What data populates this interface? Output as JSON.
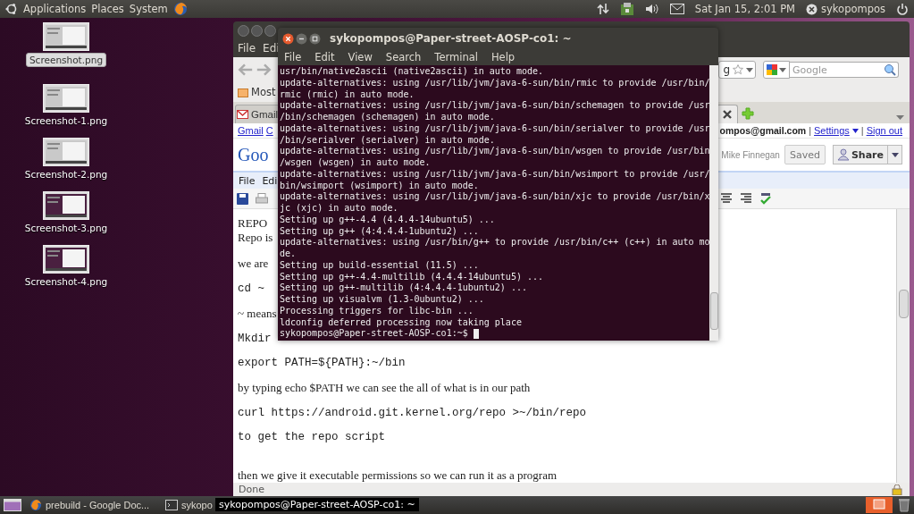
{
  "top_panel": {
    "menus": [
      "Applications",
      "Places",
      "System"
    ],
    "clock": "Sat Jan 15, 2:01 PM",
    "user": "sykopompos"
  },
  "desktop_icons": [
    {
      "label": "Screenshot.png",
      "selected": true
    },
    {
      "label": "Screenshot-1.png",
      "selected": false
    },
    {
      "label": "Screenshot-2.png",
      "selected": false
    },
    {
      "label": "Screenshot-3.png",
      "selected": false
    },
    {
      "label": "Screenshot-4.png",
      "selected": false
    }
  ],
  "firefox": {
    "menu": [
      "File",
      "Edi"
    ],
    "address_partial": "g",
    "search": {
      "placeholder": "Google"
    },
    "bookmarks": [
      "Most"
    ],
    "tabs": [
      {
        "label": "Gmail",
        "selected": false
      }
    ],
    "google_bar": {
      "links": [
        "Gmail",
        "C"
      ],
      "account": "ompos@gmail.com",
      "separators": [
        "|",
        "|"
      ],
      "settings": "Settings",
      "sign_out": "Sign out"
    },
    "docs": {
      "logo": "Goo",
      "byline": "Mike Finnegan",
      "saved": "Saved",
      "share": "Share",
      "menu": [
        "File",
        "Edi"
      ]
    },
    "document": [
      {
        "kind": "heading",
        "text": "REPO"
      },
      {
        "kind": "text",
        "text": "Repo is"
      },
      {
        "kind": "text",
        "text": "we are"
      },
      {
        "kind": "code",
        "text": "cd ~"
      },
      {
        "kind": "text",
        "text": "~ means"
      },
      {
        "kind": "code",
        "text": "Mkdir"
      },
      {
        "kind": "code",
        "text": "export PATH=${PATH}:~/bin"
      },
      {
        "kind": "text",
        "text": "by typing echo $PATH we can see the all of what is in our path"
      },
      {
        "kind": "code",
        "text": "curl https://android.git.kernel.org/repo >~/bin/repo"
      },
      {
        "kind": "code",
        "text": "to get the repo script"
      },
      {
        "kind": "text",
        "text": "then we give it executable permissions so we can run it as a program"
      }
    ],
    "status": "Done"
  },
  "terminal": {
    "title": "sykopompos@Paper-street-AOSP-co1: ~",
    "menu": [
      "File",
      "Edit",
      "View",
      "Search",
      "Terminal",
      "Help"
    ],
    "lines": [
      "usr/bin/native2ascii (native2ascii) in auto mode.",
      "update-alternatives: using /usr/lib/jvm/java-6-sun/bin/rmic to provide /usr/bin/",
      "rmic (rmic) in auto mode.",
      "update-alternatives: using /usr/lib/jvm/java-6-sun/bin/schemagen to provide /usr",
      "/bin/schemagen (schemagen) in auto mode.",
      "update-alternatives: using /usr/lib/jvm/java-6-sun/bin/serialver to provide /usr",
      "/bin/serialver (serialver) in auto mode.",
      "update-alternatives: using /usr/lib/jvm/java-6-sun/bin/wsgen to provide /usr/bin",
      "/wsgen (wsgen) in auto mode.",
      "update-alternatives: using /usr/lib/jvm/java-6-sun/bin/wsimport to provide /usr/",
      "bin/wsimport (wsimport) in auto mode.",
      "update-alternatives: using /usr/lib/jvm/java-6-sun/bin/xjc to provide /usr/bin/x",
      "jc (xjc) in auto mode.",
      "Setting up g++-4.4 (4.4.4-14ubuntu5) ...",
      "Setting up g++ (4:4.4.4-1ubuntu2) ...",
      "update-alternatives: using /usr/bin/g++ to provide /usr/bin/c++ (c++) in auto mo",
      "de.",
      "Setting up build-essential (11.5) ...",
      "Setting up g++-4.4-multilib (4.4.4-14ubuntu5) ...",
      "Setting up g++-multilib (4:4.4.4-1ubuntu2) ...",
      "Setting up visualvm (1.3-0ubuntu2) ...",
      "Processing triggers for libc-bin ...",
      "ldconfig deferred processing now taking place"
    ],
    "prompt": "sykopompos@Paper-street-AOSP-co1:~$"
  },
  "taskbar": {
    "tasks": [
      {
        "kind": "browser",
        "label": "prebuild - Google Doc..."
      },
      {
        "kind": "terminal",
        "label": "sykopo"
      }
    ],
    "tooltip": "sykopompos@Paper-street-AOSP-co1: ~"
  }
}
